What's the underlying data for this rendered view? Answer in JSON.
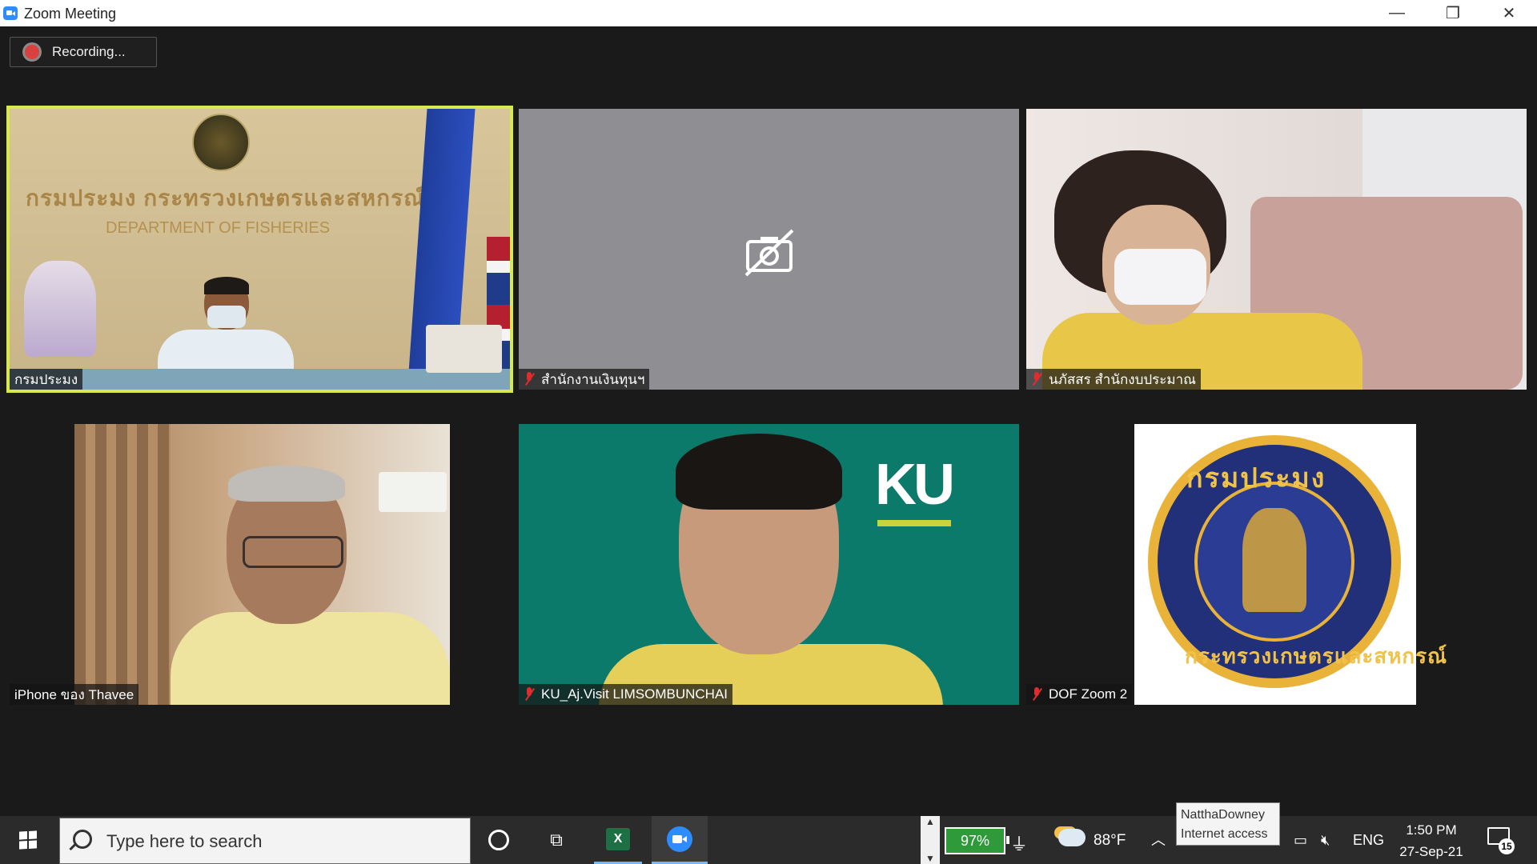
{
  "window": {
    "title": "Zoom Meeting",
    "minimize": "—",
    "restore": "❐",
    "close": "✕"
  },
  "recording": {
    "label": "Recording..."
  },
  "participants": [
    {
      "name": "กรมประมง",
      "muted": false,
      "active_speaker": true
    },
    {
      "name": "สำนักงานเงินทุนฯ",
      "muted": true,
      "camera_off": true
    },
    {
      "name": "นภัสสร  สำนักงบประมาณ",
      "muted": true
    },
    {
      "name": "iPhone ของ Thavee",
      "muted": false
    },
    {
      "name": "KU_Aj.Visit LIMSOMBUNCHAI",
      "muted": true
    },
    {
      "name": "DOF Zoom 2",
      "muted": true
    }
  ],
  "video_text": {
    "dept_wall_thai": "กรมประมง กระทรวงเกษตรและสหกรณ์",
    "dept_wall_en": "DEPARTMENT OF FISHERIES",
    "ku_logo": "KU",
    "logo_top": "กรมประมง",
    "logo_bottom": "กระทรวงเกษตรและสหกรณ์"
  },
  "taskbar": {
    "search_placeholder": "Type here to search",
    "battery": "97%",
    "weather": "88°F",
    "tooltip_line1": "NatthaDowney",
    "tooltip_line2": "Internet access",
    "language": "ENG",
    "time": "1:50 PM",
    "date": "27-Sep-21",
    "notifications": "15"
  },
  "colors": {
    "active_border": "#d7e94d",
    "zoom_blue": "#2d8cff",
    "mute_red": "#e02c2c",
    "ku_green": "#0c7a6a"
  }
}
